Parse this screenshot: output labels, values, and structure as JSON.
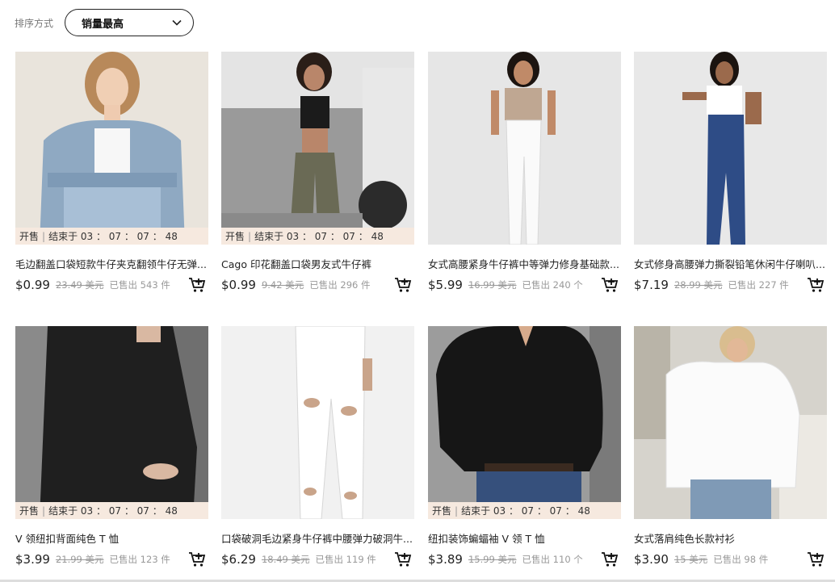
{
  "sort": {
    "label": "排序方式",
    "value": "销量最高"
  },
  "timer": {
    "prefix": "开售",
    "sep": "|",
    "text": "结束于 03 ： 07 ： 07 ： 48"
  },
  "products": [
    {
      "title": "毛边翻盖口袋短款牛仔夹克翻领牛仔无弹...",
      "price": "$0.99",
      "orig": "23.49 美元",
      "sold": "已售出 543 件",
      "flash": true
    },
    {
      "title": "Cago 印花翻盖口袋男友式牛仔裤",
      "price": "$0.99",
      "orig": "9.42 美元",
      "sold": "已售出 296 件",
      "flash": true
    },
    {
      "title": "女式高腰紧身牛仔裤中等弹力修身基础款...",
      "price": "$5.99",
      "orig": "16.99 美元",
      "sold": "已售出 240 个",
      "flash": false
    },
    {
      "title": "女式修身高腰弹力撕裂铅笔休闲牛仔喇叭...",
      "price": "$7.19",
      "orig": "28.99 美元",
      "sold": "已售出 227 件",
      "flash": false
    },
    {
      "title": "V 领纽扣背面纯色 T 恤",
      "price": "$3.99",
      "orig": "21.99 美元",
      "sold": "已售出 123 件",
      "flash": true
    },
    {
      "title": "口袋破洞毛边紧身牛仔裤中腰弹力破洞牛...",
      "price": "$6.29",
      "orig": "18.49 美元",
      "sold": "已售出 119 件",
      "flash": false
    },
    {
      "title": "纽扣装饰蝙蝠袖 V 领 T 恤",
      "price": "$3.89",
      "orig": "15.99 美元",
      "sold": "已售出 110 个",
      "flash": true
    },
    {
      "title": "女式落肩纯色长款衬衫",
      "price": "$3.90",
      "orig": "15 美元",
      "sold": "已售出 98 件",
      "flash": false
    }
  ],
  "icons": {
    "cart": "add-to-cart-icon",
    "dropdown": "chevron-down-icon"
  }
}
